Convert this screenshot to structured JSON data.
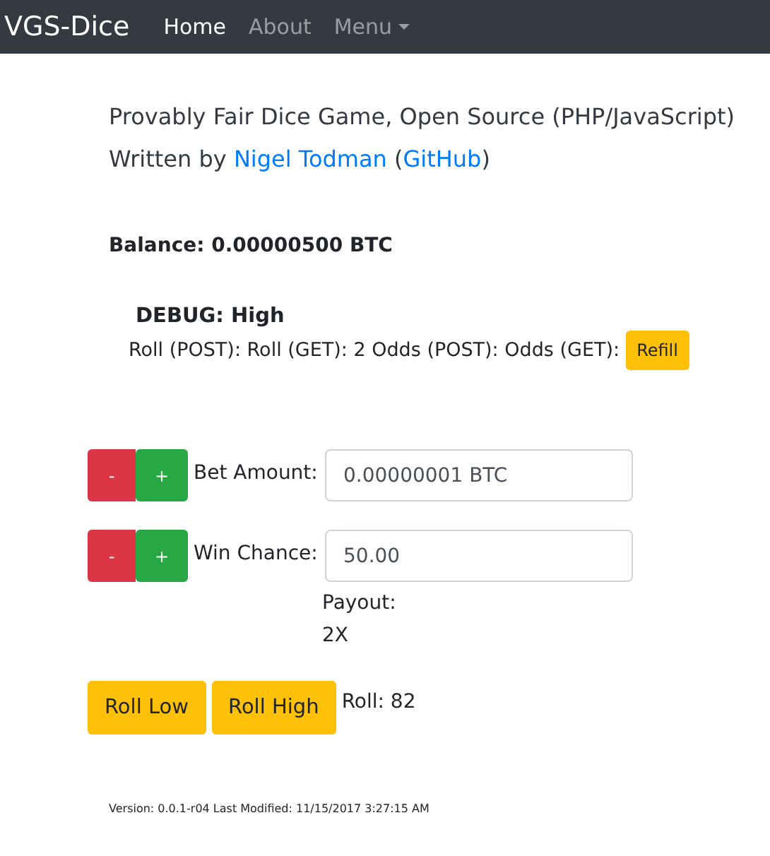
{
  "navbar": {
    "brand": "VGS-Dice",
    "items": [
      {
        "label": "Home",
        "selected": true,
        "kind": "link"
      },
      {
        "label": "About",
        "selected": false,
        "kind": "link"
      },
      {
        "label": "Menu",
        "selected": false,
        "kind": "dropdown"
      }
    ]
  },
  "intro": {
    "title": "Provably Fair Dice Game, Open Source (PHP/JavaScript)",
    "byline": {
      "prefix": "Written by ",
      "author": "Nigel Todman",
      "middle": " (",
      "link": "GitHub",
      "suffix": ")"
    }
  },
  "balance": "Balance: 0.00000500 BTC",
  "debug": {
    "title": "DEBUG: High",
    "line": "Roll (POST): Roll (GET): 2 Odds (POST): Odds (GET):",
    "button": "Refill"
  },
  "fields": [
    {
      "label": "Bet Amount:",
      "value": "0.00000001 BTC",
      "minus": "-",
      "plus": "+"
    },
    {
      "label": "Win Chance:",
      "value": "50.00",
      "minus": "-",
      "plus": "+"
    }
  ],
  "payout": {
    "label": "Payout:",
    "value": "2X"
  },
  "roll_buttons": [
    "Roll Low",
    "Roll High"
  ],
  "roll_result": "Roll: 82",
  "footer": "Version: 0.0.1-r04 Last Modified: 11/15/2017 3:27:15 AM"
}
